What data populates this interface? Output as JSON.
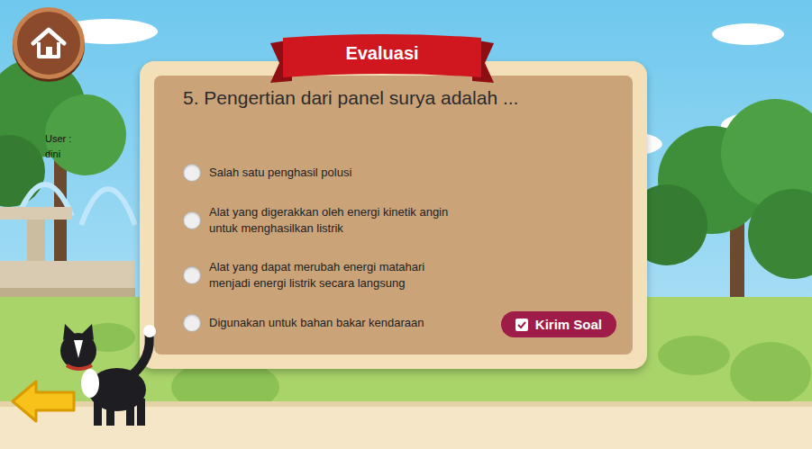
{
  "header": {
    "title": "Evaluasi"
  },
  "user": {
    "label": "User :",
    "name": "dini"
  },
  "question": {
    "text": "5. Pengertian dari panel surya adalah ..."
  },
  "options": [
    {
      "text": "Salah satu penghasil polusi",
      "selected": false
    },
    {
      "text": "Alat yang digerakkan oleh energi kinetik angin untuk menghasilkan listrik",
      "selected": false
    },
    {
      "text": "Alat yang dapat merubah energi matahari menjadi energi listrik secara langsung",
      "selected": false
    },
    {
      "text": "Digunakan untuk bahan bakar kendaraan",
      "selected": false
    }
  ],
  "submit": {
    "label": "Kirim Soal"
  }
}
